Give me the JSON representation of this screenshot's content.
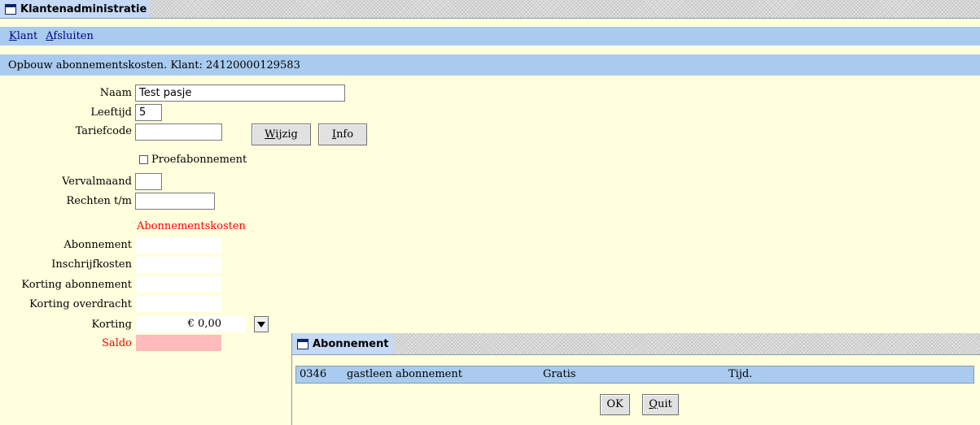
{
  "window": {
    "title": "Klantenadministratie"
  },
  "menu": {
    "items": [
      {
        "accel": "K",
        "rest": "lant"
      },
      {
        "accel": "A",
        "rest": "fsluiten"
      }
    ]
  },
  "header": {
    "text": "Opbouw abonnementskosten. Klant: 24120000129583"
  },
  "form": {
    "naam_label": "Naam",
    "naam_value": "Test pasje",
    "leeftijd_label": "Leeftijd",
    "leeftijd_value": "5",
    "tariefcode_label": "Tariefcode",
    "tariefcode_value": "",
    "wijzig_button": {
      "accel": "W",
      "rest": "ijzig"
    },
    "info_button": {
      "accel": "I",
      "rest": "nfo"
    },
    "proef_label": "Proefabonnement",
    "proef_checked": false,
    "vervalmaand_label": "Vervalmaand",
    "vervalmaand_value": "",
    "rechten_label": "Rechten t/m",
    "rechten_value": ""
  },
  "costs": {
    "section_title": "Abonnementskosten",
    "abonnement_label": "Abonnement",
    "abonnement_value": "",
    "inschrijf_label": "Inschrijfkosten",
    "inschrijf_value": "",
    "korting_abon_label": "Korting abonnement",
    "korting_abon_value": "",
    "korting_over_label": "Korting overdracht",
    "korting_over_value": "",
    "korting_label": "Korting",
    "korting_value": "€ 0,00",
    "saldo_label": "Saldo",
    "saldo_value": ""
  },
  "dialog": {
    "title": "Abonnement",
    "row": {
      "code": "0346",
      "name": "gastleen abonnement",
      "price": "Gratis",
      "type": "Tijd."
    },
    "ok_label": "OK",
    "quit_button": {
      "accel": "Q",
      "rest": "uit"
    }
  },
  "colors": {
    "background": "#ffffdd",
    "bar": "#a9cbef",
    "saldo": "#ffbbbb",
    "accent_red": "#ff0000"
  }
}
